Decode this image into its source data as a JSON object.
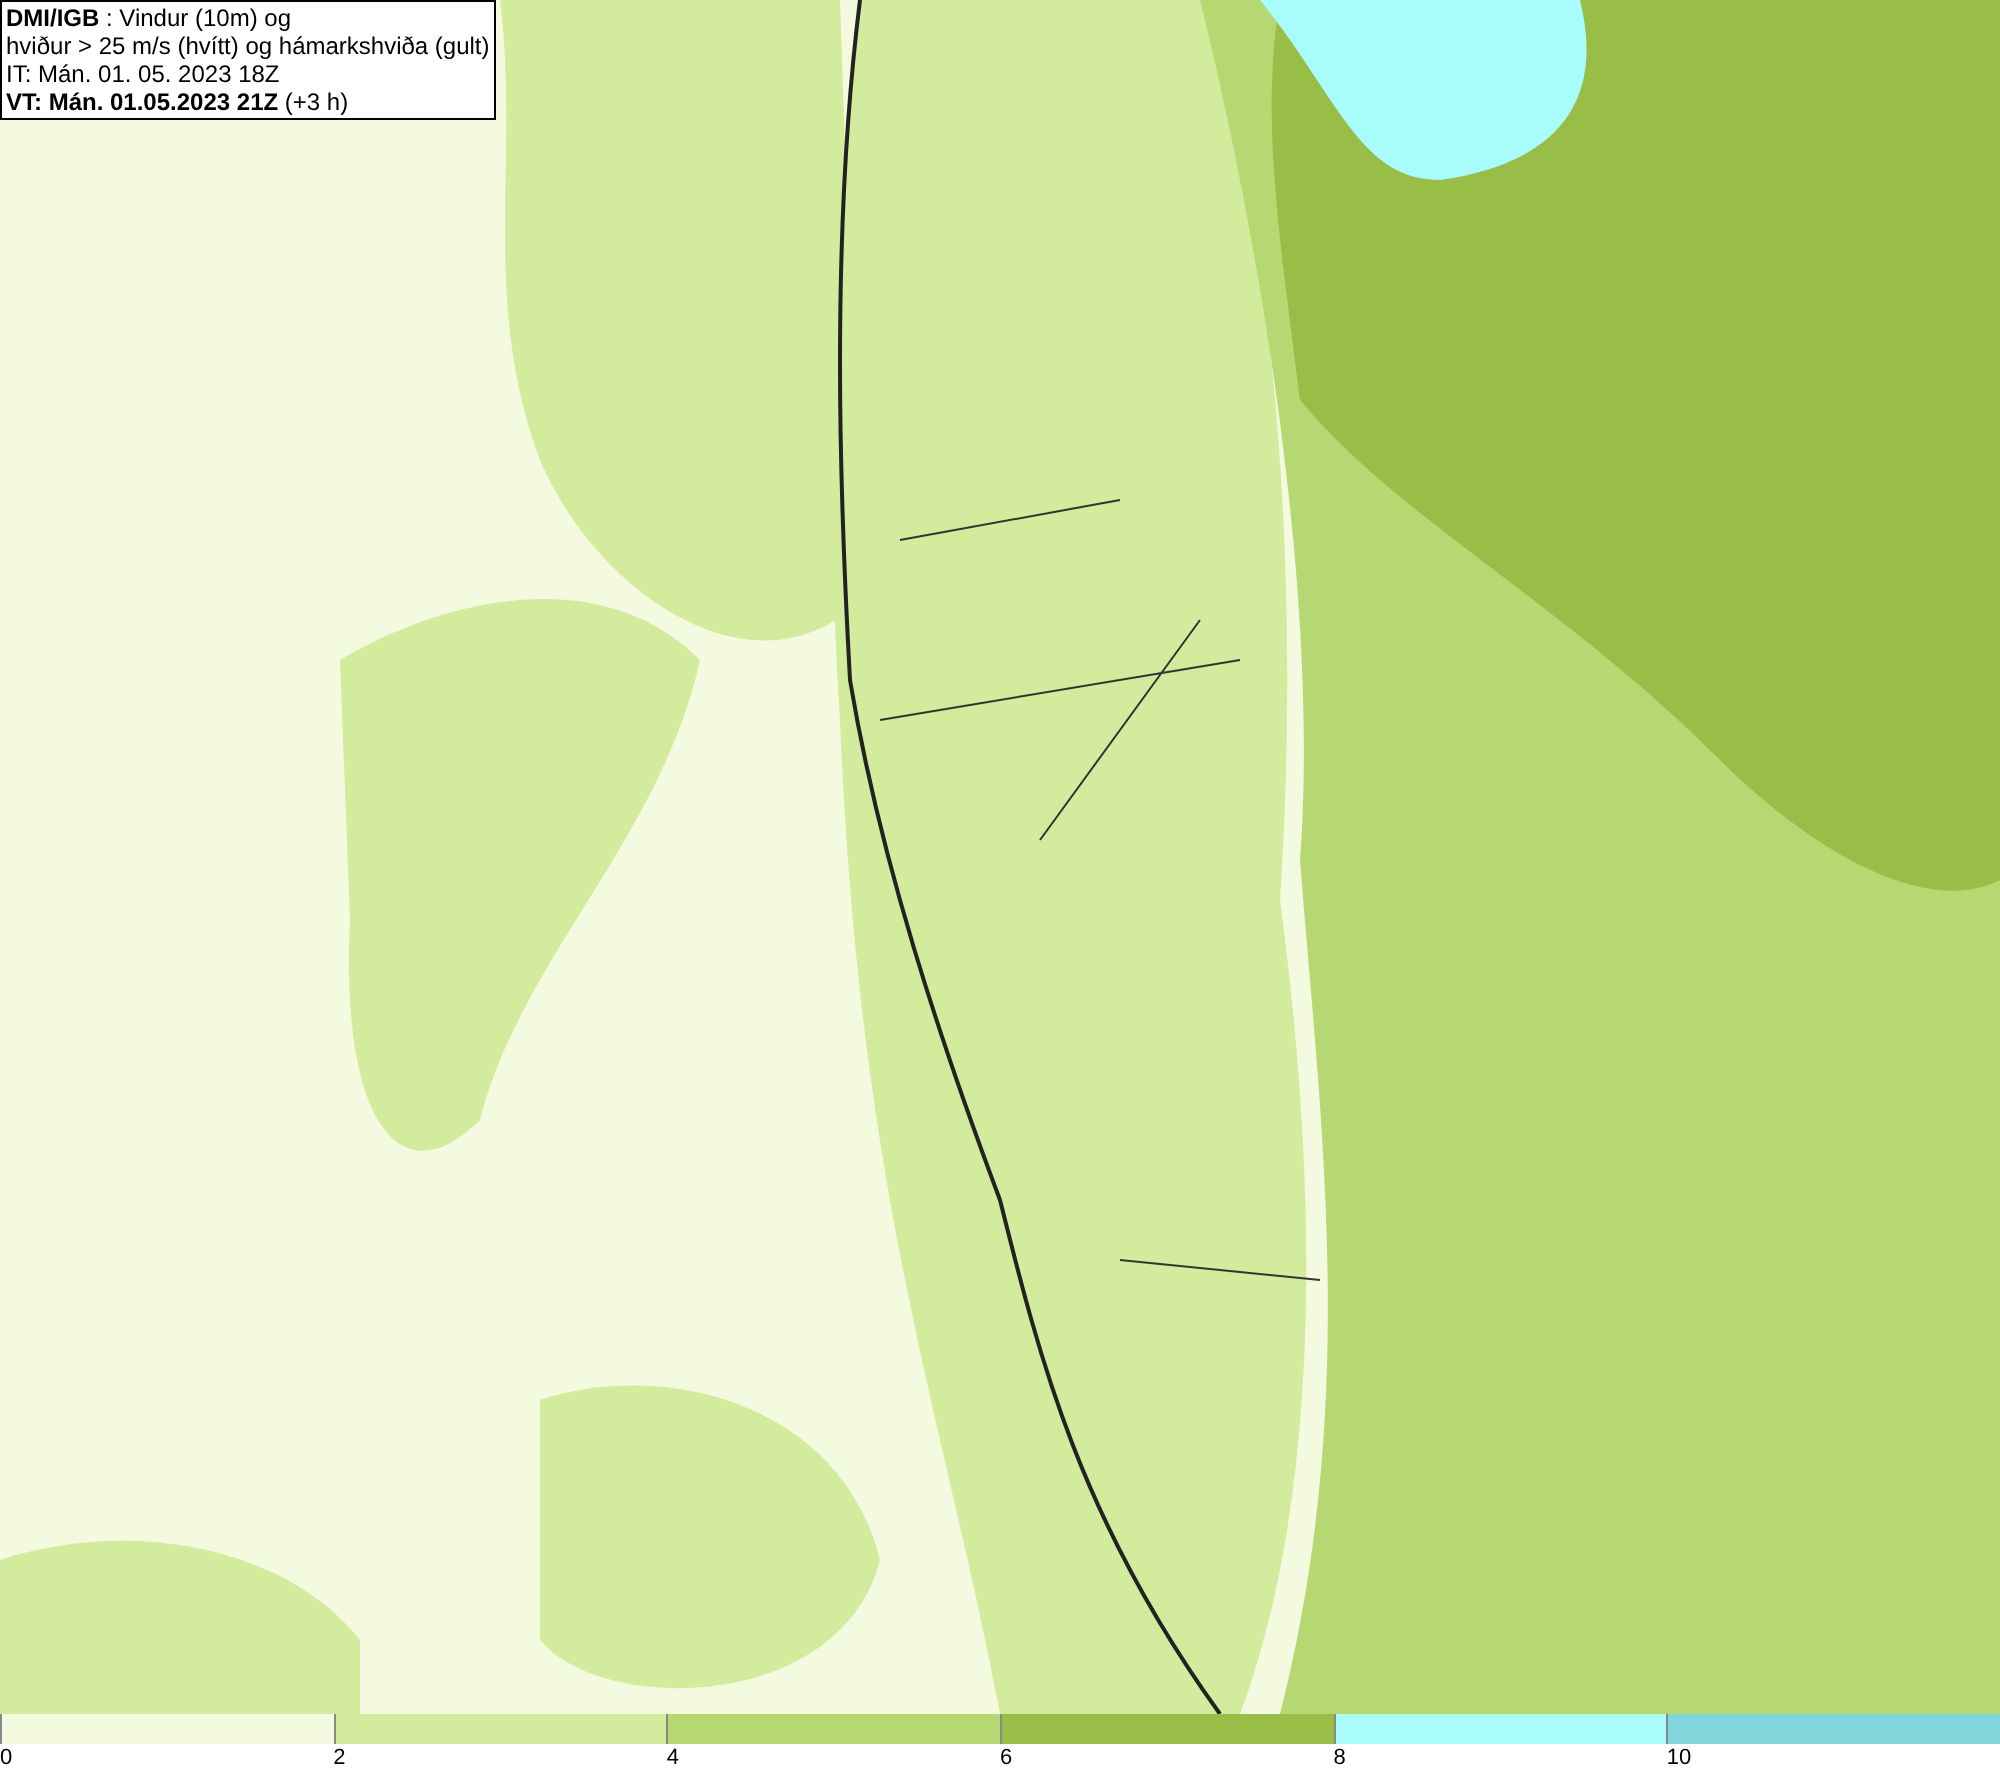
{
  "header": {
    "lines": [
      "**DMI/IGB** : Vindur (10m) og",
      "hviður > 25 m/s (hvítt) og hámarkshviða (gult)",
      "IT: Mán. 01. 05. 2023 18Z",
      "**VT: Mán. 01.05.2023 21Z** (+3 h)"
    ]
  },
  "legend": {
    "bins": [
      {
        "color": "#f3fadf"
      },
      {
        "color": "#d3eb9c"
      },
      {
        "color": "#b5d873"
      },
      {
        "color": "#98be48"
      },
      {
        "color": "#a8fcfc"
      },
      {
        "color": "#80d6da"
      }
    ],
    "ticks": [
      "0",
      "2",
      "4",
      "6",
      "8",
      "10"
    ]
  }
}
